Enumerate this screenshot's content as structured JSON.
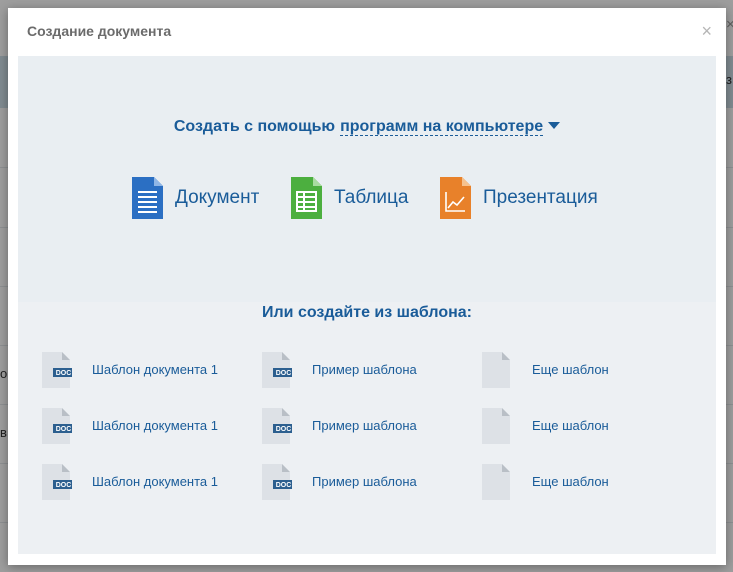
{
  "dialog": {
    "title": "Создание документа",
    "close_symbol": "×"
  },
  "background_fragments": {
    "right_edge": "з",
    "left_row_1": "ог",
    "left_row_2": "в"
  },
  "desktop": {
    "prefix": "Создать с помощью",
    "dropdown_label": "программ на компьютере",
    "apps": [
      {
        "label": "Документ",
        "icon": "document-icon",
        "color": "#2b6fc3"
      },
      {
        "label": "Таблица",
        "icon": "spreadsheet-icon",
        "color": "#4caf3f"
      },
      {
        "label": "Презентация",
        "icon": "presentation-icon",
        "color": "#e8812a"
      }
    ]
  },
  "templates": {
    "heading": "Или создайте из шаблона:",
    "rows": [
      [
        {
          "label": "Шаблон документа 1",
          "badge": "DOC"
        },
        {
          "label": "Пример шаблона",
          "badge": "DOC"
        },
        {
          "label": "Еще шаблон",
          "badge": ""
        }
      ],
      [
        {
          "label": "Шаблон документа 1",
          "badge": "DOC"
        },
        {
          "label": "Пример шаблона",
          "badge": "DOC"
        },
        {
          "label": "Еще шаблон",
          "badge": ""
        }
      ],
      [
        {
          "label": "Шаблон документа 1",
          "badge": "DOC"
        },
        {
          "label": "Пример шаблона",
          "badge": "DOC"
        },
        {
          "label": "Еще шаблон",
          "badge": ""
        }
      ]
    ]
  },
  "colors": {
    "link": "#1a5c99",
    "panel": "#edf0f3"
  }
}
